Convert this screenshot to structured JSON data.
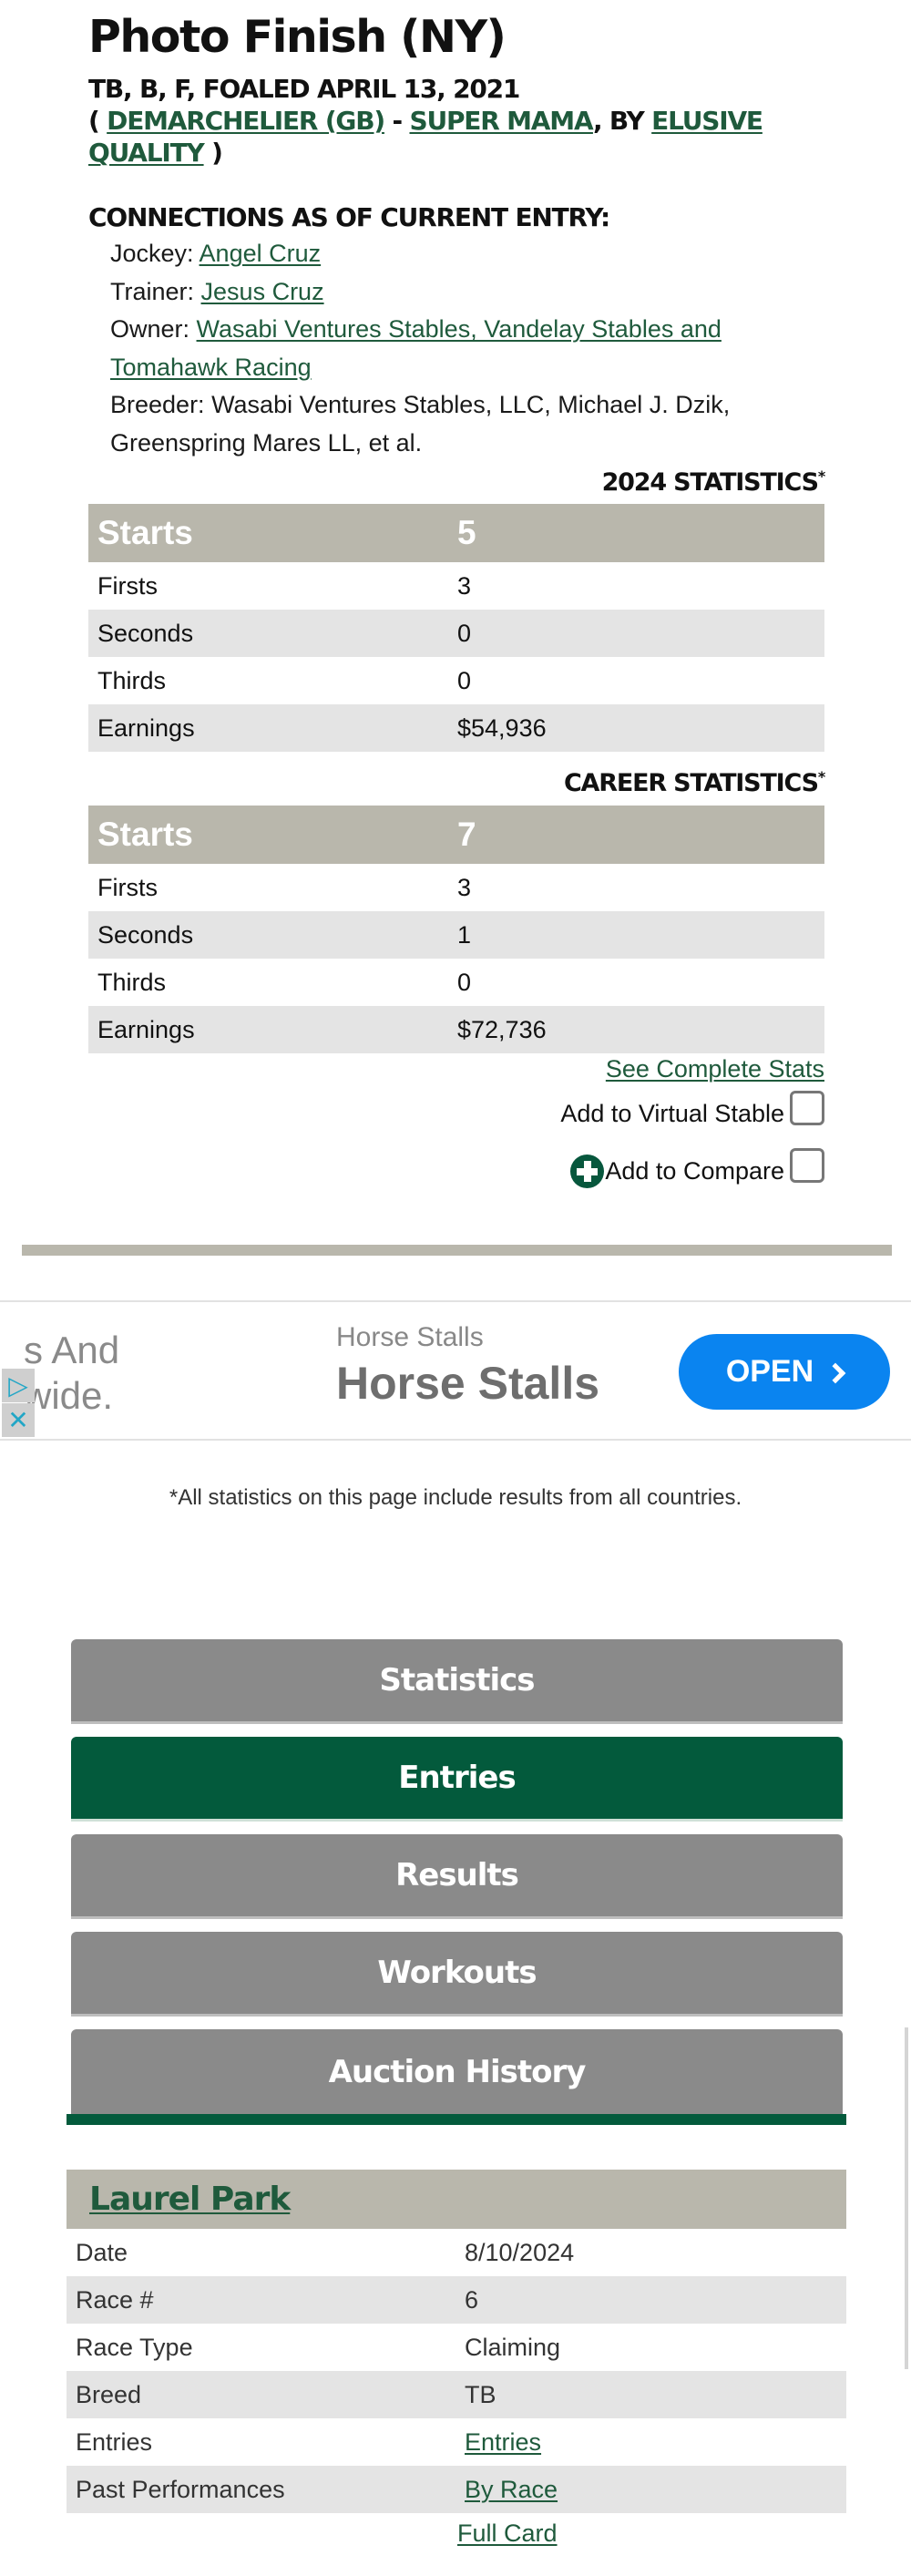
{
  "horse": {
    "name": "Photo Finish (NY)",
    "details": "TB, B, F, FOALED APRIL 13, 2021",
    "pedigree": {
      "open": "( ",
      "sire": "DEMARCHELIER (GB)",
      "sep1": " - ",
      "dam": "SUPER MAMA",
      "sep2": ", BY ",
      "damsire": "ELUSIVE QUALITY",
      "close": " )"
    }
  },
  "connections": {
    "title": "CONNECTIONS AS OF CURRENT ENTRY:",
    "jockey_label": "Jockey: ",
    "jockey": "Angel Cruz",
    "trainer_label": "Trainer: ",
    "trainer": "Jesus Cruz",
    "owner_label": "Owner: ",
    "owner": "Wasabi Ventures Stables, Vandelay Stables and Tomahawk Racing",
    "breeder_label": "Breeder: ",
    "breeder": "Wasabi Ventures Stables, LLC, Michael J. Dzik, Greenspring Mares LL, et al."
  },
  "stats_2024": {
    "title": "2024 STATISTICS",
    "asterisk": "*",
    "header": {
      "label": "Starts",
      "value": "5"
    },
    "rows": [
      {
        "label": "Firsts",
        "value": "3"
      },
      {
        "label": "Seconds",
        "value": "0"
      },
      {
        "label": "Thirds",
        "value": "0"
      },
      {
        "label": "Earnings",
        "value": "$54,936"
      }
    ]
  },
  "stats_career": {
    "title": "CAREER STATISTICS",
    "asterisk": "*",
    "header": {
      "label": "Starts",
      "value": "7"
    },
    "rows": [
      {
        "label": "Firsts",
        "value": "3"
      },
      {
        "label": "Seconds",
        "value": "1"
      },
      {
        "label": "Thirds",
        "value": "0"
      },
      {
        "label": "Earnings",
        "value": "$72,736"
      }
    ]
  },
  "actions": {
    "see_complete_stats": "See Complete Stats",
    "add_virtual_stable": "Add to Virtual Stable",
    "add_compare": "Add to Compare",
    "virtual_stable_checked": false,
    "compare_checked": false
  },
  "ad": {
    "left_text_line1": "s And",
    "left_text_line2": "wide.",
    "small_title": "Horse Stalls",
    "big_title": "Horse Stalls",
    "open_label": "OPEN",
    "adchoices_glyph": "▷",
    "close_glyph": "✕"
  },
  "footnote": "*All statistics on this page include results from all countries.",
  "tabs": [
    {
      "label": "Statistics",
      "active": false
    },
    {
      "label": "Entries",
      "active": true
    },
    {
      "label": "Results",
      "active": false
    },
    {
      "label": "Workouts",
      "active": false
    },
    {
      "label": "Auction History",
      "active": false
    }
  ],
  "entry": {
    "track": "Laurel Park",
    "rows": [
      {
        "label": "Date",
        "value": "8/10/2024"
      },
      {
        "label": "Race #",
        "value": "6"
      },
      {
        "label": "Race Type",
        "value": "Claiming"
      },
      {
        "label": "Breed",
        "value": "TB"
      },
      {
        "label": "Entries",
        "value": "Entries"
      },
      {
        "label": "Past Performances",
        "value": "By Race"
      }
    ],
    "full_card": "Full Card"
  },
  "colors": {
    "brand_green": "#035a3c",
    "link_green": "#1f5a3c",
    "table_header": "#b9b7ac",
    "tab_inactive": "#8a8a8a",
    "ad_button": "#0a84f0"
  }
}
